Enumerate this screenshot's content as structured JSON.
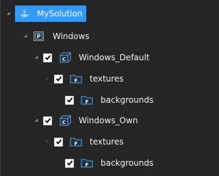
{
  "tree": {
    "solution": {
      "label": "MySolution",
      "icon": "solution-icon",
      "selected": true
    },
    "project": {
      "label": "Windows",
      "icon": "project-icon"
    },
    "configs": [
      {
        "label": "Windows_Default",
        "checked": true,
        "icon": "config-icon",
        "folders": [
          {
            "label": "textures",
            "checked": true,
            "icon": "folder-icon"
          },
          {
            "label": "backgrounds",
            "checked": true,
            "icon": "folder-icon"
          }
        ]
      },
      {
        "label": "Windows_Own",
        "checked": true,
        "icon": "config-icon",
        "folders": [
          {
            "label": "textures",
            "checked": true,
            "icon": "folder-icon"
          },
          {
            "label": "backgrounds",
            "checked": true,
            "icon": "folder-icon"
          }
        ]
      }
    ]
  },
  "colors": {
    "background": "#252526",
    "selection": "#3399ff",
    "text": "#f1f1f1",
    "icon_blue": "#5aa7e8"
  }
}
